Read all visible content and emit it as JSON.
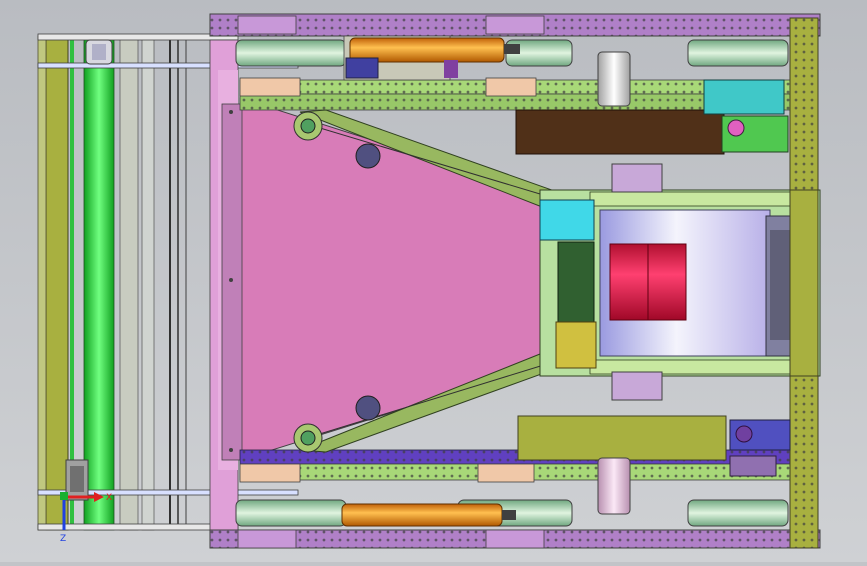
{
  "viewport": {
    "background": "#c4c6ca"
  },
  "triad": {
    "x_label": "X",
    "y_label": "Y",
    "z_label": "Z",
    "x_color": "#e02020",
    "y_color": "#18b030",
    "z_color": "#2040e0"
  },
  "parts": [
    {
      "name": "front-frame-rail",
      "color": "#a8b040"
    },
    {
      "name": "front-roller",
      "color": "#30e840"
    },
    {
      "name": "base-plate",
      "color": "#d87cb8"
    },
    {
      "name": "side-rail-purple",
      "color": "#a060c0"
    },
    {
      "name": "side-rail-green",
      "color": "#a8d878"
    },
    {
      "name": "rear-frame-rail",
      "color": "#a8b040"
    },
    {
      "name": "wheel",
      "color": "#a8d8a0"
    },
    {
      "name": "pneumatic-cylinder",
      "color": "#f0a020"
    },
    {
      "name": "intake-arm",
      "color": "#98b860"
    },
    {
      "name": "drum",
      "color": "#d8d8f0"
    },
    {
      "name": "drum-band",
      "color": "#e02850"
    },
    {
      "name": "gearbox-block",
      "color": "#503018"
    },
    {
      "name": "cyan-bearing-block",
      "color": "#40d8e8"
    },
    {
      "name": "motor-teal",
      "color": "#40c8c8"
    }
  ]
}
